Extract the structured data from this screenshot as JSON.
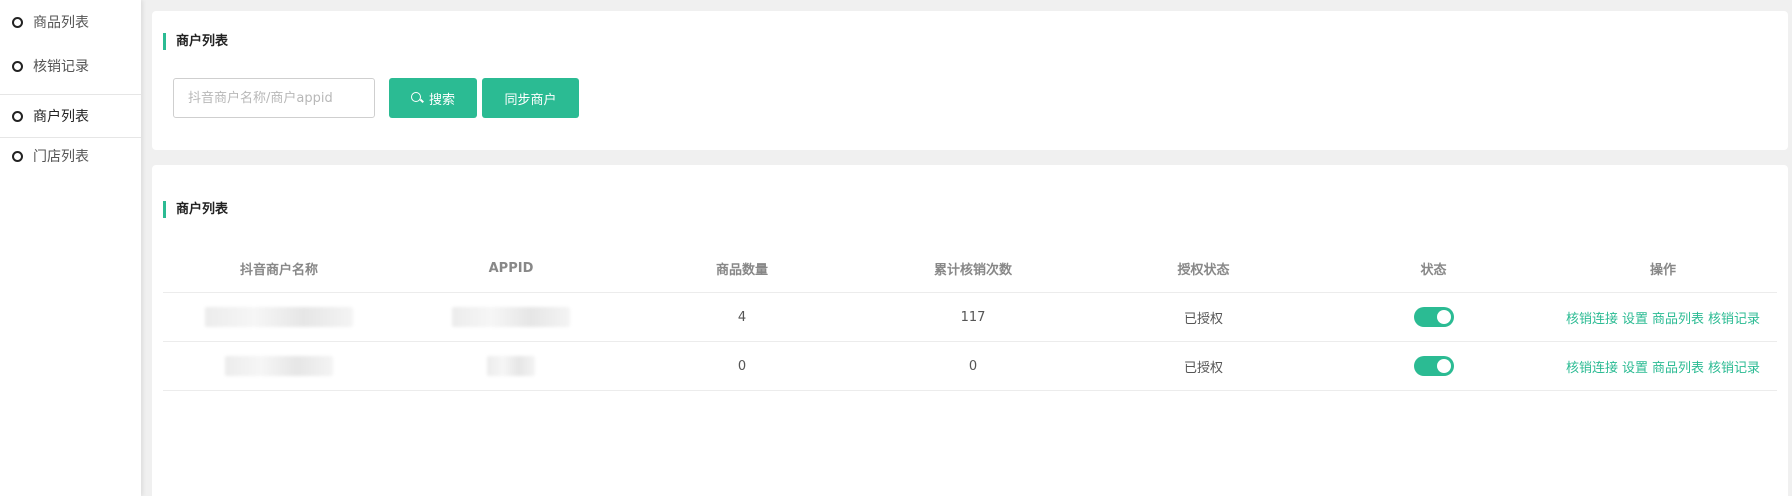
{
  "sidebar": {
    "items": [
      {
        "label": "商品列表"
      },
      {
        "label": "核销记录"
      },
      {
        "label": "商户列表"
      },
      {
        "label": "门店列表"
      }
    ]
  },
  "search_section": {
    "title": "商户列表",
    "input_placeholder": "抖音商户名称/商户appid",
    "search_label": "搜索",
    "sync_label": "同步商户"
  },
  "table_section": {
    "title": "商户列表",
    "columns": [
      "抖音商户名称",
      "APPID",
      "商品数量",
      "累计核销次数",
      "授权状态",
      "状态",
      "操作"
    ],
    "rows": [
      {
        "product_count": "4",
        "verify_count": "117",
        "auth_status": "已授权",
        "enabled": true
      },
      {
        "product_count": "0",
        "verify_count": "0",
        "auth_status": "已授权",
        "enabled": true
      }
    ],
    "actions": [
      "核销连接",
      "设置",
      "商品列表",
      "核销记录"
    ]
  },
  "colors": {
    "accent": "#2bbb93"
  }
}
